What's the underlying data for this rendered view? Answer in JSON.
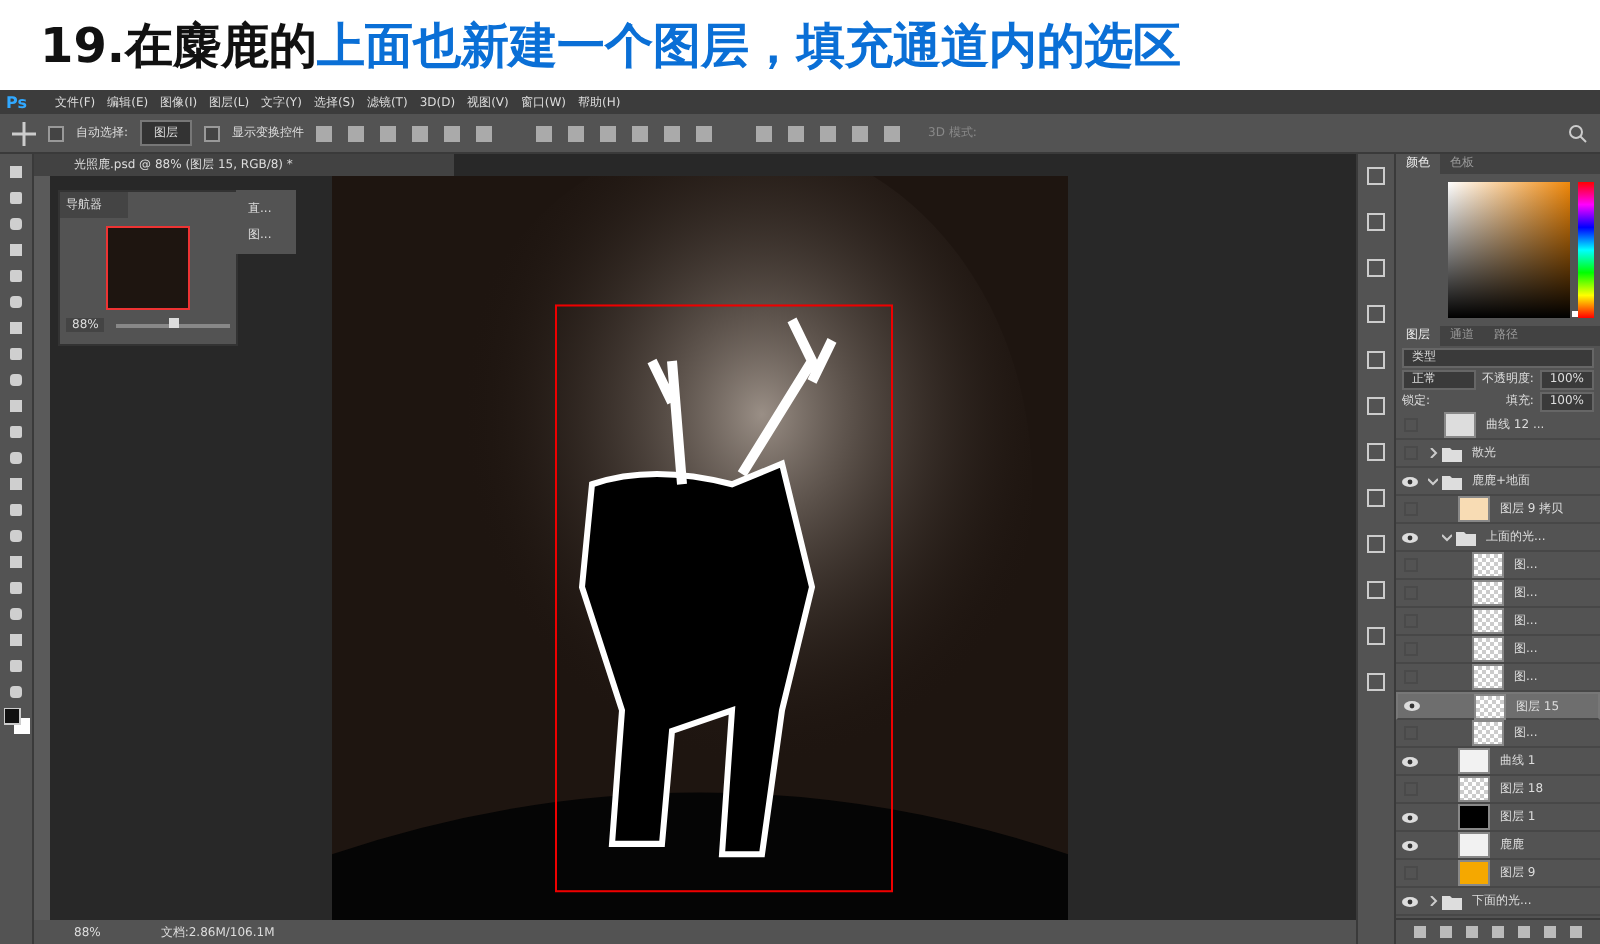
{
  "title": {
    "prefix": "19.在麋鹿的",
    "highlight": "上面也新建一个图层，填充通道内的选区"
  },
  "app_logo": "Ps",
  "menu": [
    "文件(F)",
    "编辑(E)",
    "图像(I)",
    "图层(L)",
    "文字(Y)",
    "选择(S)",
    "滤镜(T)",
    "3D(D)",
    "视图(V)",
    "窗口(W)",
    "帮助(H)"
  ],
  "options": {
    "auto_select": {
      "label": "自动选择:",
      "checked": false
    },
    "target": "图层",
    "show_transform": {
      "label": "显示变换控件",
      "checked": false
    },
    "mode_3d": "3D 模式:"
  },
  "document_tab": {
    "title": "光照鹿.psd @ 88% (图层 15, RGB/8) *"
  },
  "navigator": {
    "title": "导航器",
    "zoom": "88%",
    "level": 0.5
  },
  "mini_panel": {
    "items": [
      "直...",
      "图..."
    ]
  },
  "status_bar": {
    "zoom": "88%",
    "doc_size": "文档:2.86M/106.1M"
  },
  "color_panel": {
    "tabs": [
      {
        "label": "颜色",
        "selected": true
      },
      {
        "label": "色板",
        "selected": false
      }
    ],
    "hue": {
      "level": 0.03
    }
  },
  "layers_panel": {
    "tabs": [
      {
        "label": "图层",
        "selected": true
      },
      {
        "label": "通道",
        "selected": false
      },
      {
        "label": "路径",
        "selected": false
      }
    ],
    "filter": "类型",
    "blend": "正常",
    "opacity_label": "不透明度:",
    "opacity": "100%",
    "lock_label": "锁定:",
    "fill_label": "填充:",
    "fill": "100%",
    "layers": [
      {
        "name": "曲线 12 ...",
        "visible": false,
        "selected": false,
        "color": "#dddddd",
        "kind": "layer"
      },
      {
        "name": "散光",
        "visible": false,
        "selected": false,
        "kind": "group",
        "expanded": false
      },
      {
        "name": "鹿鹿+地面",
        "visible": true,
        "selected": false,
        "kind": "group",
        "expanded": true,
        "children": [
          {
            "name": "图层 9 拷贝",
            "visible": false,
            "selected": false,
            "color": "#f8dcb4",
            "kind": "layer"
          },
          {
            "name": "上面的光...",
            "visible": true,
            "selected": false,
            "kind": "group",
            "expanded": true,
            "children": [
              {
                "name": "图...",
                "visible": false,
                "selected": false,
                "kind": "layer"
              },
              {
                "name": "图...",
                "visible": false,
                "selected": false,
                "kind": "layer"
              },
              {
                "name": "图...",
                "visible": false,
                "selected": false,
                "kind": "layer"
              },
              {
                "name": "图...",
                "visible": false,
                "selected": false,
                "kind": "layer"
              },
              {
                "name": "图...",
                "visible": false,
                "selected": false,
                "kind": "layer"
              },
              {
                "name": "图层 15",
                "visible": true,
                "selected": true,
                "kind": "layer"
              },
              {
                "name": "图...",
                "visible": false,
                "selected": false,
                "kind": "layer"
              }
            ]
          },
          {
            "name": "曲线 1",
            "visible": true,
            "selected": false,
            "color": "#f2f2f2",
            "kind": "layer"
          },
          {
            "name": "图层 18",
            "visible": false,
            "selected": false,
            "kind": "layer"
          },
          {
            "name": "图层 1",
            "visible": true,
            "selected": false,
            "color": "#000000",
            "kind": "layer"
          },
          {
            "name": "鹿鹿",
            "visible": true,
            "selected": false,
            "color": "#f2f2f2",
            "kind": "layer"
          },
          {
            "name": "图层 9",
            "visible": false,
            "selected": false,
            "color": "#f5a800",
            "kind": "layer"
          }
        ]
      },
      {
        "name": "下面的光...",
        "visible": true,
        "selected": false,
        "kind": "group",
        "expanded": false
      }
    ]
  }
}
